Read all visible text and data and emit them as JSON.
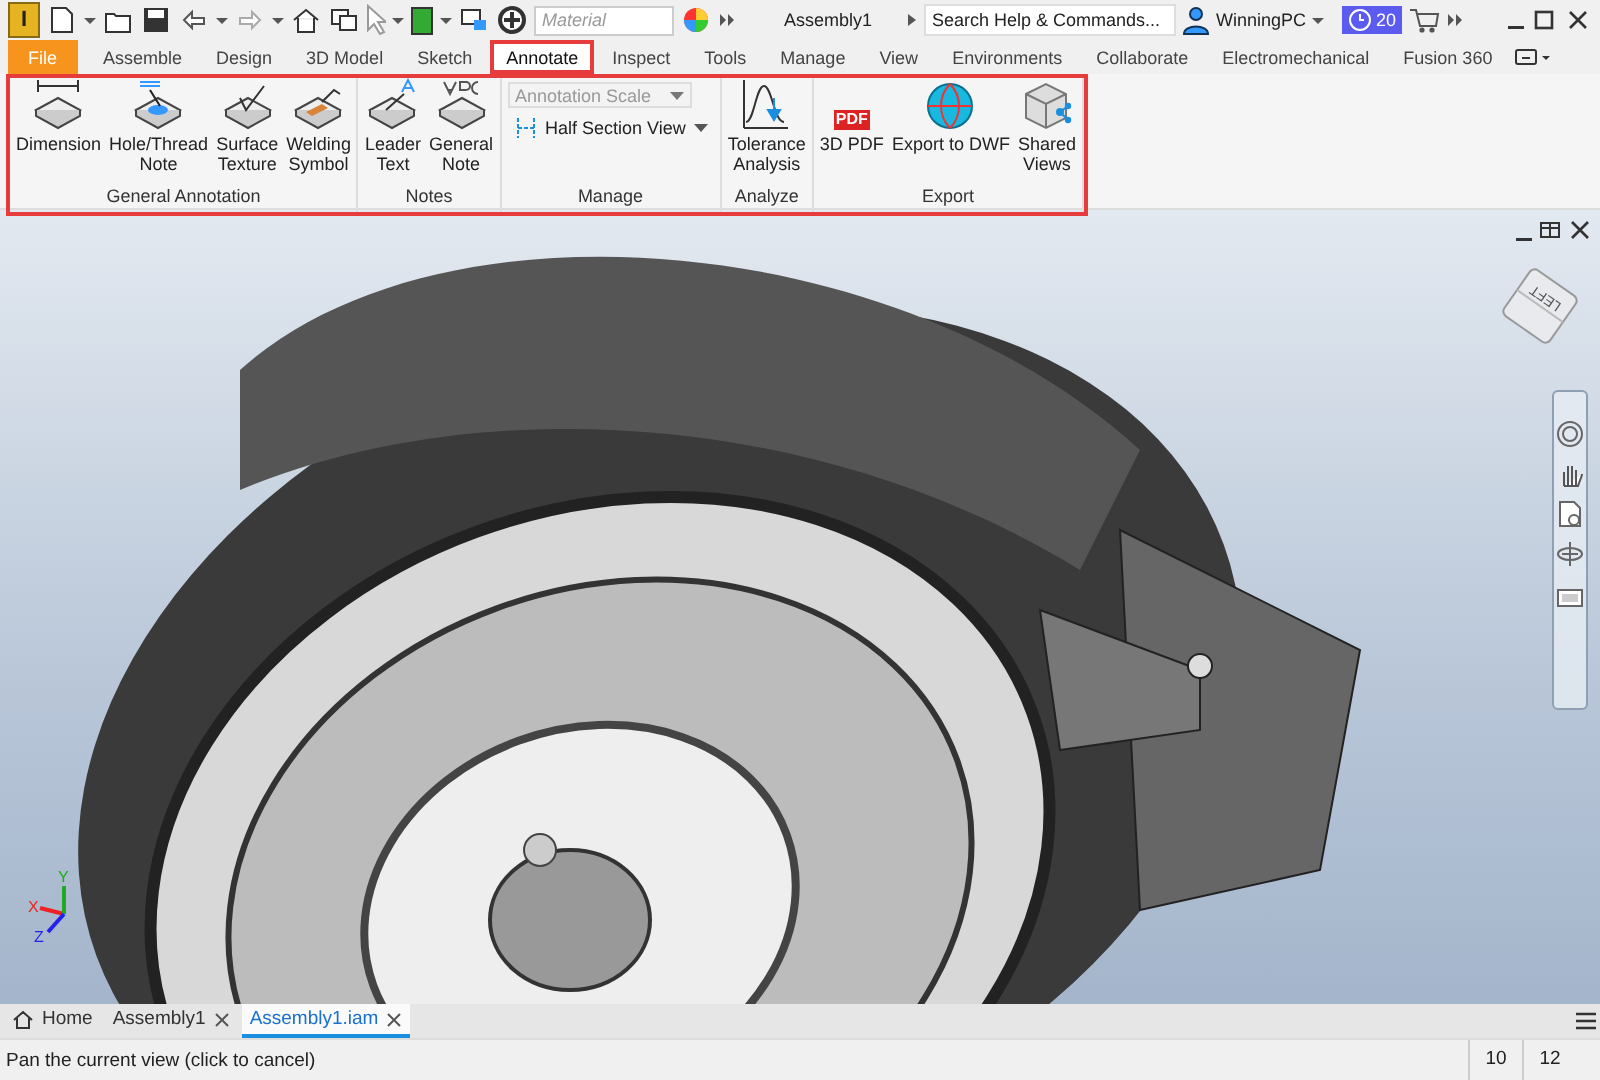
{
  "logo": "I",
  "material": {
    "placeholder": "Material"
  },
  "app_title": "Assembly1",
  "search": {
    "placeholder": "Search Help & Commands..."
  },
  "user": {
    "name": "WinningPC"
  },
  "trial": {
    "days": "20"
  },
  "ribbon_tabs": [
    {
      "label": "File",
      "kind": "file",
      "selected": false,
      "highlighted": false
    },
    {
      "label": "Assemble",
      "kind": "tab",
      "selected": false,
      "highlighted": false
    },
    {
      "label": "Design",
      "kind": "tab",
      "selected": false,
      "highlighted": false
    },
    {
      "label": "3D Model",
      "kind": "tab",
      "selected": false,
      "highlighted": false
    },
    {
      "label": "Sketch",
      "kind": "tab",
      "selected": false,
      "highlighted": false
    },
    {
      "label": "Annotate",
      "kind": "tab",
      "selected": true,
      "highlighted": true
    },
    {
      "label": "Inspect",
      "kind": "tab",
      "selected": false,
      "highlighted": false
    },
    {
      "label": "Tools",
      "kind": "tab",
      "selected": false,
      "highlighted": false
    },
    {
      "label": "Manage",
      "kind": "tab",
      "selected": false,
      "highlighted": false
    },
    {
      "label": "View",
      "kind": "tab",
      "selected": false,
      "highlighted": false
    },
    {
      "label": "Environments",
      "kind": "tab",
      "selected": false,
      "highlighted": false
    },
    {
      "label": "Collaborate",
      "kind": "tab",
      "selected": false,
      "highlighted": false
    },
    {
      "label": "Electromechanical",
      "kind": "tab",
      "selected": false,
      "highlighted": false
    },
    {
      "label": "Fusion 360",
      "kind": "tab",
      "selected": false,
      "highlighted": false
    }
  ],
  "ribbon": {
    "highlighted": true,
    "panels": [
      {
        "title": "General Annotation",
        "tools": [
          {
            "label": "Dimension"
          },
          {
            "label": "Hole/Thread\nNote"
          },
          {
            "label": "Surface\nTexture"
          },
          {
            "label": "Welding\nSymbol"
          }
        ]
      },
      {
        "title": "Notes",
        "tools": [
          {
            "label": "Leader\nText"
          },
          {
            "label": "General\nNote"
          }
        ]
      },
      {
        "title": "Manage",
        "controls": [
          {
            "label": "Annotation Scale",
            "kind": "dropdown",
            "disabled": true
          },
          {
            "label": "Half Section View",
            "kind": "split",
            "disabled": false
          }
        ]
      },
      {
        "title": "Analyze",
        "tools": [
          {
            "label": "Tolerance\nAnalysis"
          }
        ]
      },
      {
        "title": "Export",
        "tools": [
          {
            "label": "3D PDF",
            "badge": "PDF"
          },
          {
            "label": "Export to DWF"
          },
          {
            "label": "Shared\nViews"
          }
        ]
      }
    ]
  },
  "viewcube": {
    "face": "LEFT"
  },
  "triad": {
    "axes": [
      "X",
      "Y",
      "Z"
    ]
  },
  "document_tabs": [
    {
      "label": "Home",
      "kind": "home",
      "selected": false
    },
    {
      "label": "Assembly1",
      "kind": "doc",
      "selected": false
    },
    {
      "label": "Assembly1.iam",
      "kind": "doc",
      "selected": true
    }
  ],
  "status_bar": {
    "message": "Pan the current view (click to cancel)",
    "counts": [
      "10",
      "12"
    ]
  }
}
